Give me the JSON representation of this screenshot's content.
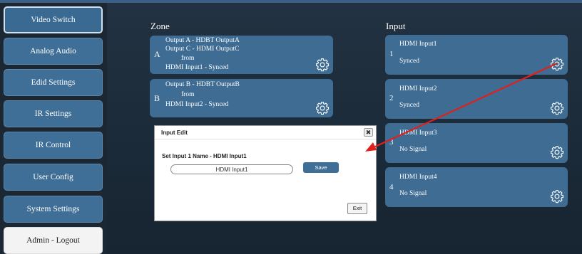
{
  "sidebar": {
    "items": [
      {
        "label": "Video Switch"
      },
      {
        "label": "Analog Audio"
      },
      {
        "label": "Edid Settings"
      },
      {
        "label": "IR Settings"
      },
      {
        "label": "IR Control"
      },
      {
        "label": "User Config"
      },
      {
        "label": "System Settings"
      },
      {
        "label": "Admin - Logout"
      }
    ]
  },
  "zone": {
    "heading": "Zone",
    "cards": [
      {
        "letter": "A",
        "lines": [
          "Output A -    HDBT OutputA",
          "Output C -    HDMI OutputC",
          "from",
          "HDMI Input1 - Synced"
        ]
      },
      {
        "letter": "B",
        "lines": [
          "Output B -    HDBT OutputB",
          "from",
          "HDMI Input2 - Synced"
        ]
      }
    ]
  },
  "input": {
    "heading": "Input",
    "cards": [
      {
        "name": "HDMI Input1",
        "num": "1",
        "status": "Synced"
      },
      {
        "name": "HDMI Input2",
        "num": "2",
        "status": "Synced"
      },
      {
        "name": "HDMI Input3",
        "num": "3",
        "status": "No Signal"
      },
      {
        "name": "HDMI Input4",
        "num": "4",
        "status": "No Signal"
      }
    ]
  },
  "dialog": {
    "title": "Input Edit",
    "close": "✖",
    "label": "Set Input 1 Name - HDMI Input1",
    "input_value": "HDMI Input1",
    "save": "Save",
    "exit": "Exit"
  },
  "colors": {
    "accent": "#3e6c93",
    "arrow": "#e0201c"
  }
}
